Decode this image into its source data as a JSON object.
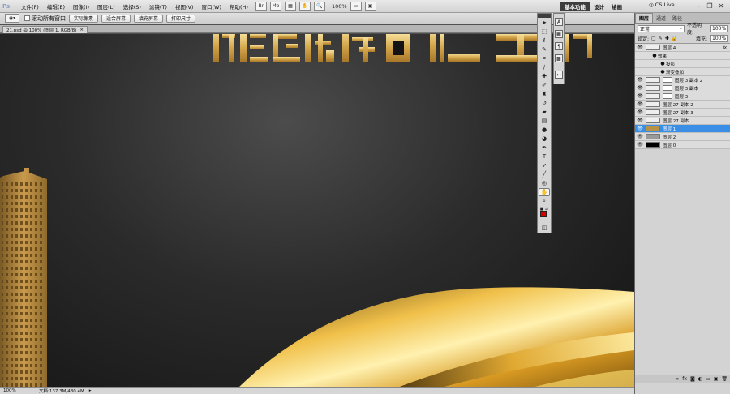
{
  "app": {
    "logo": "Ps"
  },
  "menu": [
    "文件(F)",
    "编辑(E)",
    "图像(I)",
    "图层(L)",
    "选择(S)",
    "滤镜(T)",
    "视图(V)",
    "窗口(W)",
    "帮助(H)"
  ],
  "appbar": {
    "zoom": "100%"
  },
  "workspaces": {
    "essentials": "基本功能",
    "design": "设计",
    "painting": "绘画"
  },
  "cslive": "CS Live",
  "options": {
    "scroll_all": "滚动所有窗口",
    "actual_pixels": "实际像素",
    "fit_screen": "适合屏幕",
    "fill_screen": "填充屏幕",
    "print_size": "打印尺寸"
  },
  "doc_tab": {
    "title": "21.psd @ 100% (图层 1, RGB/8)",
    "close": "×"
  },
  "status": {
    "zoom": "100%",
    "doc_info": "文档:137.3M/480.4M"
  },
  "colors": {
    "accent": "#3a8ee6",
    "foreground": "#d30000",
    "gold": "#c9962e"
  },
  "layers_panel": {
    "tabs": [
      "图层",
      "通道",
      "路径"
    ],
    "blend_mode": "正常",
    "opacity_label": "不透明度:",
    "opacity": "100%",
    "lock_label": "锁定:",
    "fill_label": "填充:",
    "fill": "100%",
    "layers": [
      {
        "name": "图层 4",
        "fx": "fx",
        "thumb": "#eeeeee"
      },
      {
        "name": "效果",
        "sub": true
      },
      {
        "name": "投影",
        "sub": true
      },
      {
        "name": "渐变叠加",
        "sub": true
      },
      {
        "name": "图层 3 副本 2",
        "thumb": "#eeeeee",
        "mask": true
      },
      {
        "name": "图层 3 副本",
        "thumb": "#eeeeee",
        "mask": true
      },
      {
        "name": "图层 3",
        "thumb": "#eeeeee",
        "mask": true
      },
      {
        "name": "图层 27 副本 2",
        "thumb": "#eeeeee"
      },
      {
        "name": "图层 27 副本 3",
        "thumb": "#eeeeee"
      },
      {
        "name": "图层 27 副本",
        "thumb": "#eeeeee"
      },
      {
        "name": "图层 1",
        "thumb": "#b89247",
        "selected": true
      },
      {
        "name": "图层 2",
        "thumb": "#999999"
      },
      {
        "name": "图层 0",
        "thumb": "#000000"
      }
    ]
  }
}
